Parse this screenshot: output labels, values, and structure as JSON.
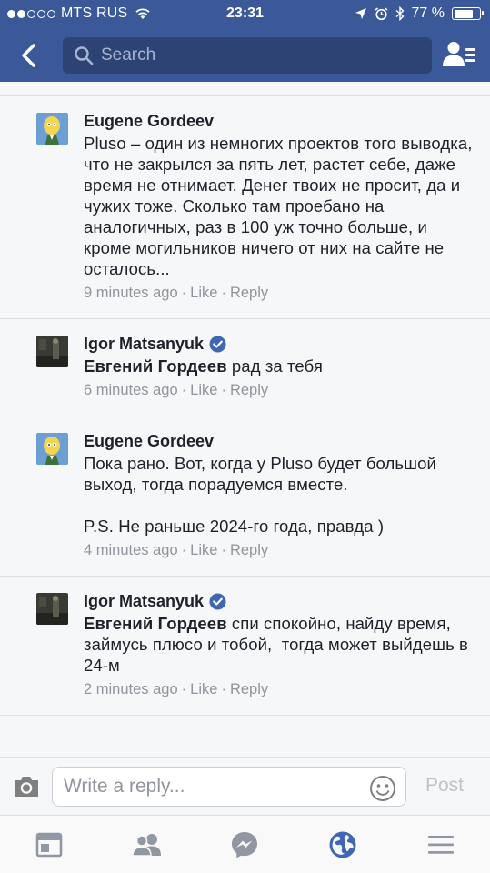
{
  "status_bar": {
    "carrier": "MTS RUS",
    "time": "23:31",
    "battery_percent": "77 %",
    "signal_bars_filled": 2,
    "signal_bars_total": 5,
    "battery_level": 0.77
  },
  "navbar": {
    "search_placeholder": "Search"
  },
  "comments": [
    {
      "author": "Eugene Gordeev",
      "verified": false,
      "mention": "",
      "text": "Pluso – один из немногих проектов того выводка, что не закрылся за пять лет, растет себе, даже время не отнимает. Денег твоих не просит, да и чужих тоже. Сколько там проебано на аналогичных, раз в 100 уж точно больше, и кроме могильников ничего от них на сайте не осталось...",
      "time": "9 minutes ago",
      "like": "Like",
      "reply": "Reply"
    },
    {
      "author": "Igor Matsanyuk",
      "verified": true,
      "mention": "Евгений Гордеев",
      "text": " рад за тебя",
      "time": "6 minutes ago",
      "like": "Like",
      "reply": "Reply"
    },
    {
      "author": "Eugene Gordeev",
      "verified": false,
      "mention": "",
      "text": "Пока рано. Вот, когда у Pluso будет большой выход, тогда порадуемся вместе.\n\nP.S. Не раньше 2024-го года, правда )",
      "time": "4 minutes ago",
      "like": "Like",
      "reply": "Reply"
    },
    {
      "author": "Igor Matsanyuk",
      "verified": true,
      "mention": "Евгений Гордеев",
      "text": " спи спокойно, найду время, займусь плюсо и тобой,  тогда может выйдешь в 24-м",
      "time": "2 minutes ago",
      "like": "Like",
      "reply": "Reply"
    }
  ],
  "reply_bar": {
    "placeholder": "Write a reply...",
    "post_label": "Post"
  },
  "tab_bar": {
    "tabs": [
      "news-feed-icon",
      "friends-icon",
      "messenger-icon",
      "notifications-globe-icon",
      "menu-icon"
    ],
    "active_index": 3
  },
  "colors": {
    "brand": "#3b5998",
    "active_tab": "#4267b2",
    "inactive_tab": "#9197a3",
    "meta_text": "#90949c"
  }
}
